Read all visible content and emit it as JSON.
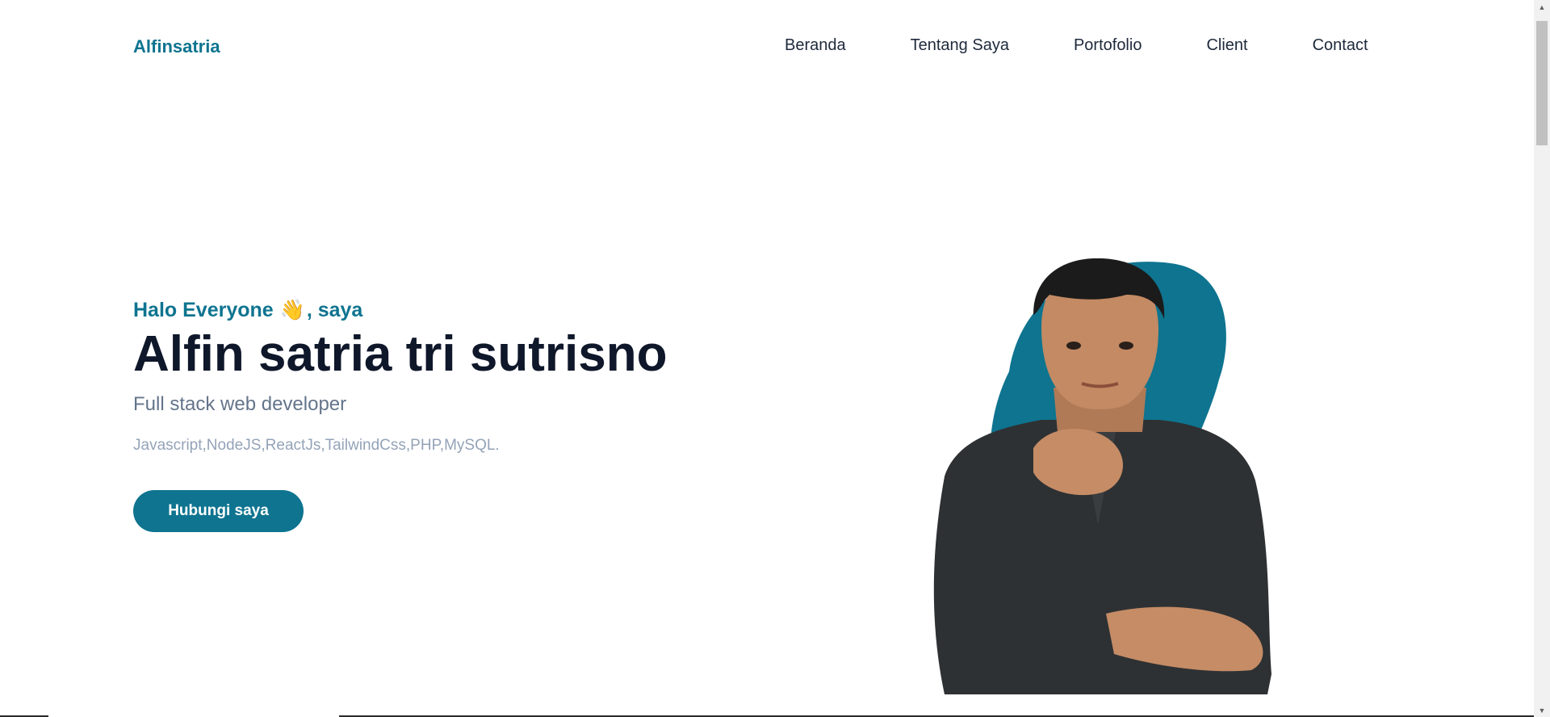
{
  "brand": {
    "logo_text": "Alfinsatria"
  },
  "nav": {
    "items": [
      {
        "label": "Beranda"
      },
      {
        "label": "Tentang Saya"
      },
      {
        "label": "Portofolio"
      },
      {
        "label": "Client"
      },
      {
        "label": "Contact"
      }
    ]
  },
  "hero": {
    "greeting_prefix": "Halo Everyone",
    "greeting_emoji": "👋",
    "greeting_suffix": ", saya",
    "name": "Alfin satria tri sutrisno",
    "role": "Full stack web developer",
    "skills": "Javascript,NodeJS,ReactJs,TailwindCss,PHP,MySQL.",
    "cta_label": "Hubungi saya"
  },
  "colors": {
    "accent": "#0e7490",
    "heading": "#0f172a",
    "body_text": "#64748b",
    "muted_text": "#94a3b8"
  },
  "icons": {
    "wave": "waving-hand-icon",
    "scroll_up": "scroll-up-arrow-icon",
    "scroll_down": "scroll-down-arrow-icon"
  }
}
